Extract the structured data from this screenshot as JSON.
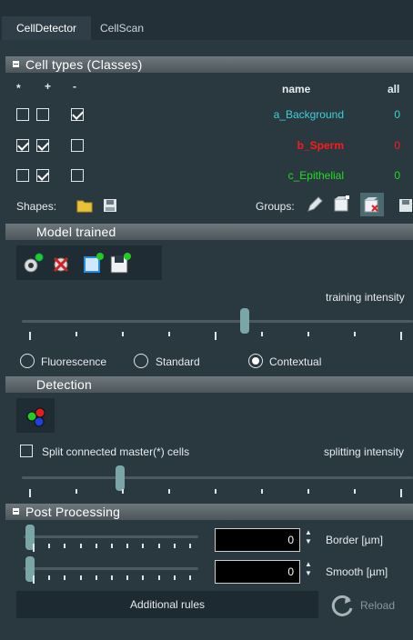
{
  "tabs": [
    {
      "label": "CellDetector",
      "active": true
    },
    {
      "label": "CellScan",
      "active": false
    }
  ],
  "cell_types": {
    "title": "Cell types (Classes)",
    "col_star": "*",
    "col_plus": "+",
    "col_minus": "-",
    "col_name": "name",
    "col_all": "all",
    "rows": [
      {
        "name": "a_Background",
        "count": "0",
        "color": "#3fd0d6",
        "star": false,
        "plus": false,
        "minus": true
      },
      {
        "name": "b_Sperm",
        "count": "0",
        "color": "#ff1a1a",
        "star": true,
        "plus": true,
        "minus": false
      },
      {
        "name": "c_Epithelial",
        "count": "0",
        "color": "#22dd22",
        "star": false,
        "plus": true,
        "minus": false
      }
    ],
    "shapes_label": "Shapes:",
    "groups_label": "Groups:"
  },
  "model": {
    "title": "Model trained",
    "training_label": "training intensity",
    "training_level": 0.57,
    "modes": [
      "Fluorescence",
      "Standard",
      "Contextual"
    ],
    "selected_mode": "Contextual"
  },
  "detection": {
    "title": "Detection",
    "split_label": "Split connected master(*) cells",
    "splitting_label": "splitting intensity",
    "splitting_level": 0.25
  },
  "post": {
    "title": "Post Processing",
    "border_value": "0",
    "border_label": "Border [µm]",
    "smooth_value": "0",
    "smooth_label": "Smooth [µm]",
    "rules_label": "Additional rules",
    "reload_label": "Reload"
  }
}
